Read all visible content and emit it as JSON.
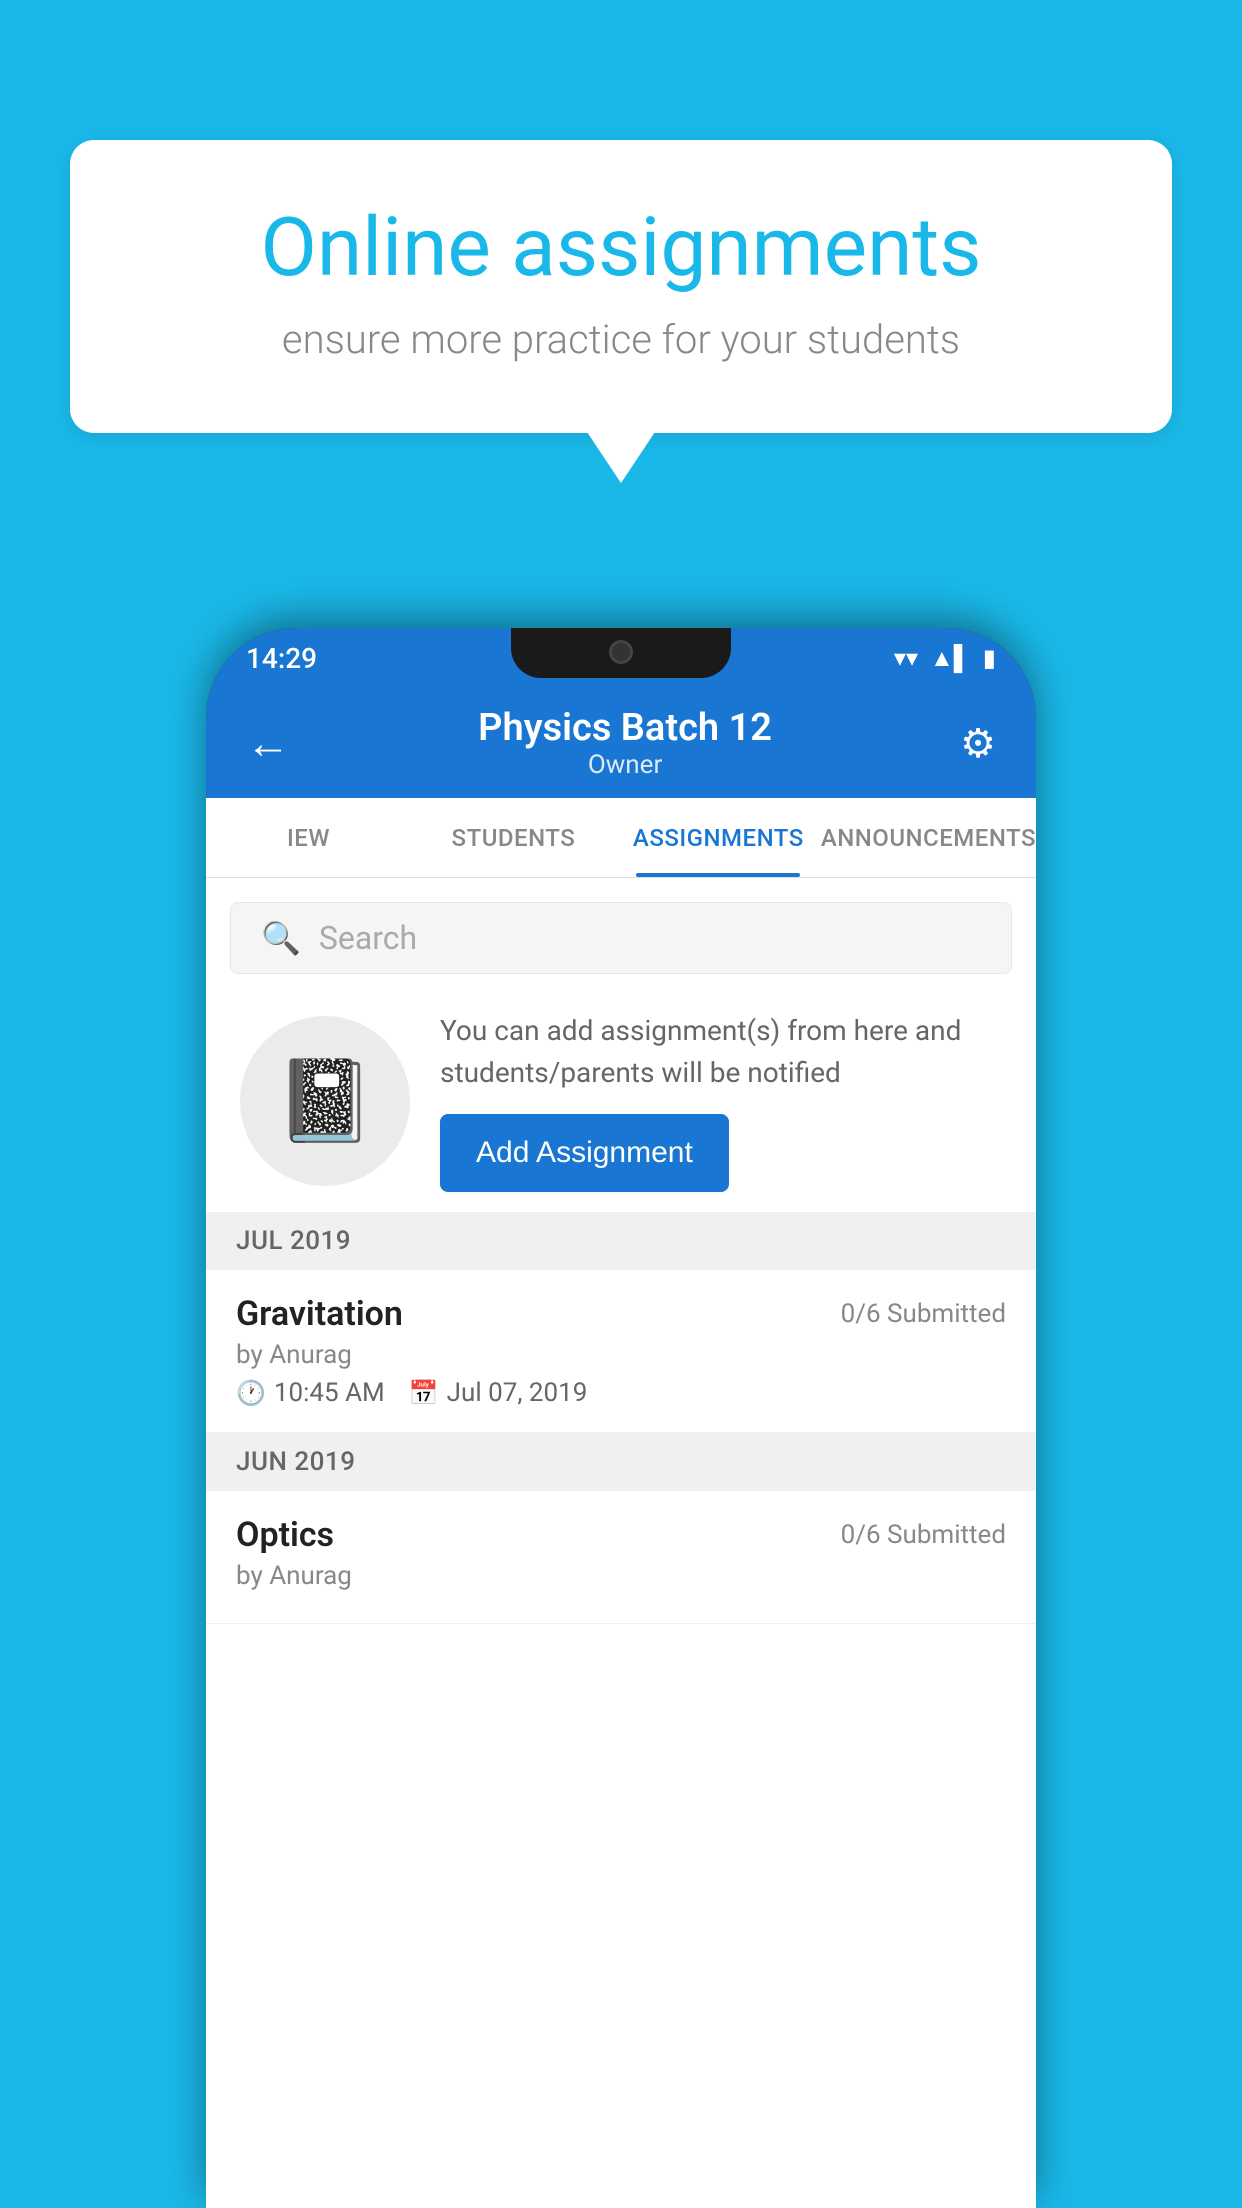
{
  "background": {
    "color": "#1ab8e8"
  },
  "speech_bubble": {
    "title": "Online assignments",
    "subtitle": "ensure more practice for your students"
  },
  "status_bar": {
    "time": "14:29",
    "wifi": "▼",
    "signal": "▲",
    "battery": "▮"
  },
  "app_header": {
    "back_icon": "←",
    "title": "Physics Batch 12",
    "subtitle": "Owner",
    "settings_icon": "⚙"
  },
  "tabs": [
    {
      "label": "IEW",
      "active": false
    },
    {
      "label": "STUDENTS",
      "active": false
    },
    {
      "label": "ASSIGNMENTS",
      "active": true
    },
    {
      "label": "ANNOUNCEMENTS",
      "active": false
    }
  ],
  "search": {
    "placeholder": "Search",
    "icon": "🔍"
  },
  "info_card": {
    "description": "You can add assignment(s) from here and students/parents will be notified",
    "add_button_label": "Add Assignment"
  },
  "sections": [
    {
      "header": "JUL 2019",
      "assignments": [
        {
          "name": "Gravitation",
          "submitted": "0/6 Submitted",
          "by": "by Anurag",
          "time": "10:45 AM",
          "date": "Jul 07, 2019"
        }
      ]
    },
    {
      "header": "JUN 2019",
      "assignments": [
        {
          "name": "Optics",
          "submitted": "0/6 Submitted",
          "by": "by Anurag",
          "time": "",
          "date": ""
        }
      ]
    }
  ]
}
